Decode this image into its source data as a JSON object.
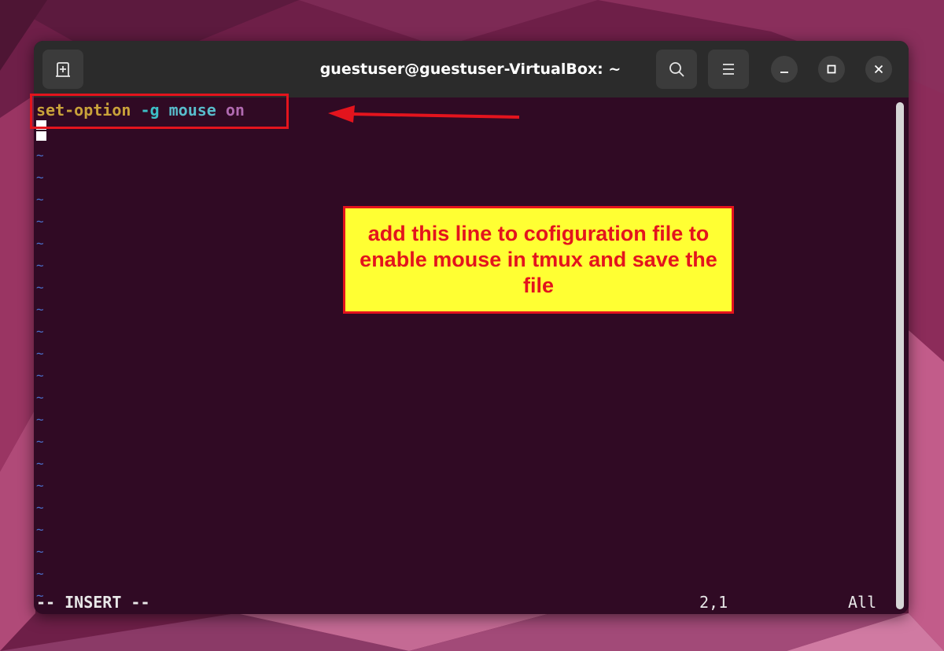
{
  "window": {
    "title": "guestuser@guestuser-VirtualBox: ~"
  },
  "icons": {
    "new_tab": "new-tab-icon",
    "search": "search-icon",
    "menu": "hamburger-menu-icon",
    "minimize": "minimize-icon",
    "maximize": "maximize-icon",
    "close": "close-icon"
  },
  "editor": {
    "line1": {
      "command": "set-option",
      "flag": "-g",
      "option": "mouse",
      "value": "on"
    },
    "tilde": "~",
    "mode": "-- INSERT --",
    "cursor_position": "2,1",
    "scroll_position": "All"
  },
  "annotation": {
    "callout_text": "add this line to cofiguration file to enable mouse in tmux and save the file"
  },
  "colors": {
    "terminal_bg": "#300a24",
    "titlebar_bg": "#2b2b2b",
    "callout_bg": "#ffff33",
    "annotation_red": "#e3141d"
  }
}
